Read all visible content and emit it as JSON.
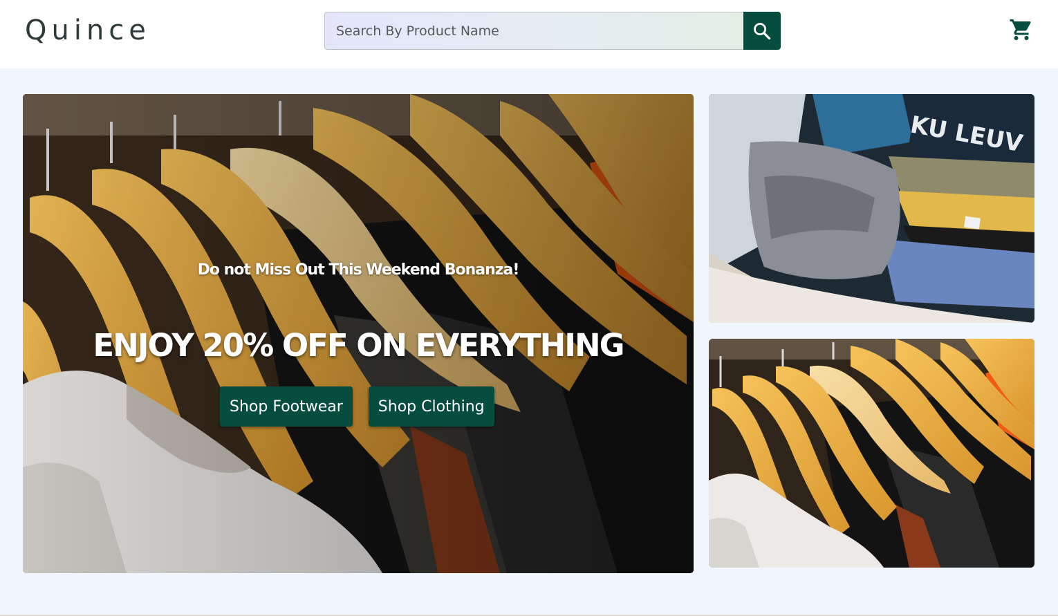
{
  "header": {
    "logo": "Quince",
    "search_placeholder": "Search By Product Name",
    "search_icon": "search-icon",
    "cart_icon": "cart-icon"
  },
  "hero": {
    "subtitle": "Do not Miss Out This Weekend Bonanza!",
    "title": "ENJOY 20% OFF ON EVERYTHING",
    "buttons": [
      {
        "label": "Shop Footwear"
      },
      {
        "label": "Shop Clothing"
      }
    ]
  },
  "side_images": [
    {
      "subject": "folded-clothes-in-drawer"
    },
    {
      "subject": "shirts-on-wooden-hangers"
    }
  ],
  "colors": {
    "brand": "#064d40",
    "page_background": "#eff6fd",
    "header_background": "#ffffff"
  }
}
